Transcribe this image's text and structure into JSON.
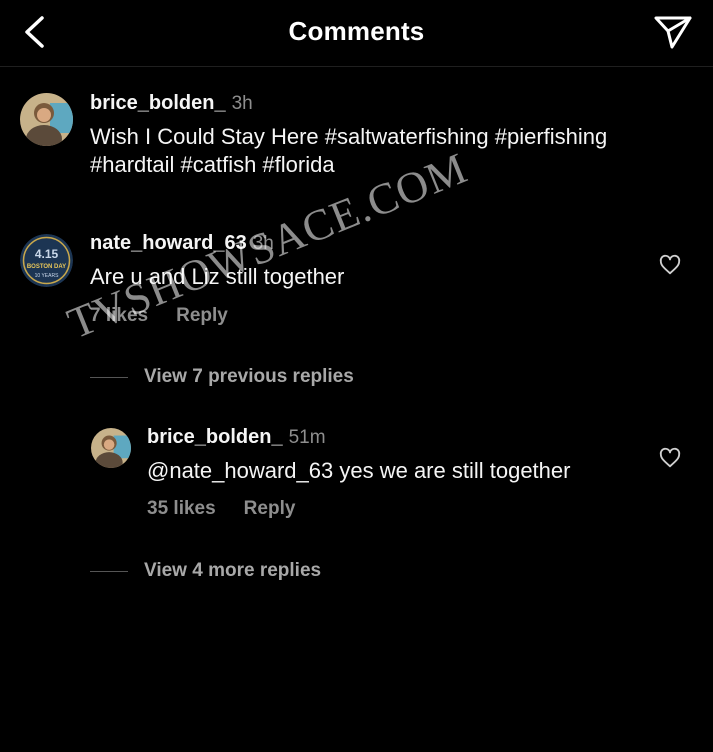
{
  "header": {
    "title": "Comments"
  },
  "caption": {
    "username": "brice_bolden_",
    "time": "3h",
    "text": "Wish I Could Stay Here #saltwaterfishing #pierfishing #hardtail #catfish #florida"
  },
  "comment": {
    "username": "nate_howard_63",
    "time": "3h",
    "text": "Are u and Liz still together",
    "likes": "7 likes",
    "reply": "Reply",
    "avatar_badge_top": "4.15",
    "avatar_badge_mid": "BOSTON DAY",
    "avatar_badge_bottom": "10 YEARS"
  },
  "view_previous": "View 7 previous replies",
  "reply": {
    "username": "brice_bolden_",
    "time": "51m",
    "text": "@nate_howard_63 yes we are still together",
    "likes": "35 likes",
    "reply": "Reply"
  },
  "view_more": "View 4 more replies",
  "watermark": "TVSHOWSACE.COM"
}
